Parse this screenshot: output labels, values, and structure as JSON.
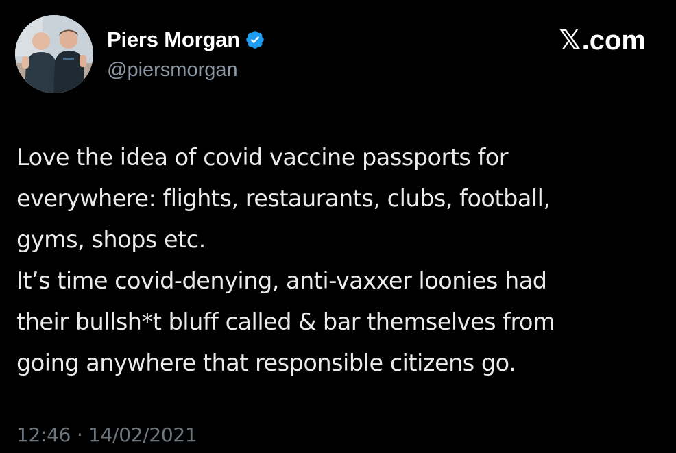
{
  "author": {
    "display_name": "Piers Morgan",
    "handle": "@piersmorgan",
    "verified_icon": "verified-badge-icon",
    "avatar": "profile-photo"
  },
  "brand": {
    "mark": "𝕏",
    "suffix": ".com"
  },
  "tweet": {
    "lines": [
      "Love the idea of covid vaccine passports for",
      "everywhere: flights, restaurants, clubs, football,",
      "gyms, shops etc.",
      "It’s time covid-denying, anti-vaxxer loonies had",
      "their bullsh*t bluff called & bar themselves from",
      "going anywhere that responsible citizens go."
    ],
    "time": "12:46",
    "separator": "·",
    "date": "14/02/2021"
  },
  "colors": {
    "background": "#000000",
    "verified": "#1d9bf0",
    "meta_text": "#6e767d"
  }
}
